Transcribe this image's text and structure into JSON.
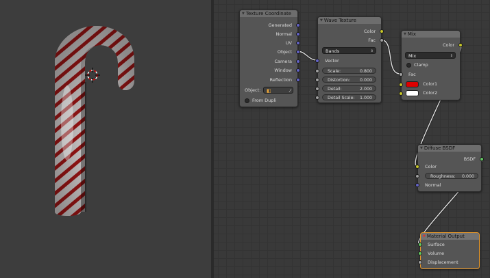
{
  "nodes": {
    "texture_coordinate": {
      "title": "Texture Coordinate",
      "outputs": [
        "Generated",
        "Normal",
        "UV",
        "Object",
        "Camera",
        "Window",
        "Reflection"
      ],
      "object_label": "Object:",
      "from_dupli_label": "From Dupli"
    },
    "wave_texture": {
      "title": "Wave Texture",
      "outputs": [
        "Color",
        "Fac"
      ],
      "type_value": "Bands",
      "vector_label": "Vector",
      "params": [
        {
          "label": "Scale:",
          "value": "0.800"
        },
        {
          "label": "Distortion:",
          "value": "0.000"
        },
        {
          "label": "Detail:",
          "value": "2.000"
        },
        {
          "label": "Detail Scale:",
          "value": "1.000"
        }
      ]
    },
    "mix": {
      "title": "Mix",
      "output": "Color",
      "blend_value": "Mix",
      "clamp_label": "Clamp",
      "fac_label": "Fac",
      "color1_label": "Color1",
      "color2_label": "Color2",
      "color1": "#dd0000",
      "color2": "#ffffff"
    },
    "diffuse_bsdf": {
      "title": "Diffuse BSDF",
      "output": "BSDF",
      "color_label": "Color",
      "roughness_label": "Roughness:",
      "roughness_value": "0.000",
      "normal_label": "Normal"
    },
    "material_output": {
      "title": "Material Output",
      "inputs": [
        "Surface",
        "Volume",
        "Displacement"
      ]
    }
  },
  "colors": {
    "socket_color": "#c7c729",
    "socket_vector": "#6363c7",
    "socket_float": "#a1a1a1",
    "socket_shader": "#63c763",
    "selected_border": "#e8982a",
    "stripe_red": "#b01818"
  }
}
